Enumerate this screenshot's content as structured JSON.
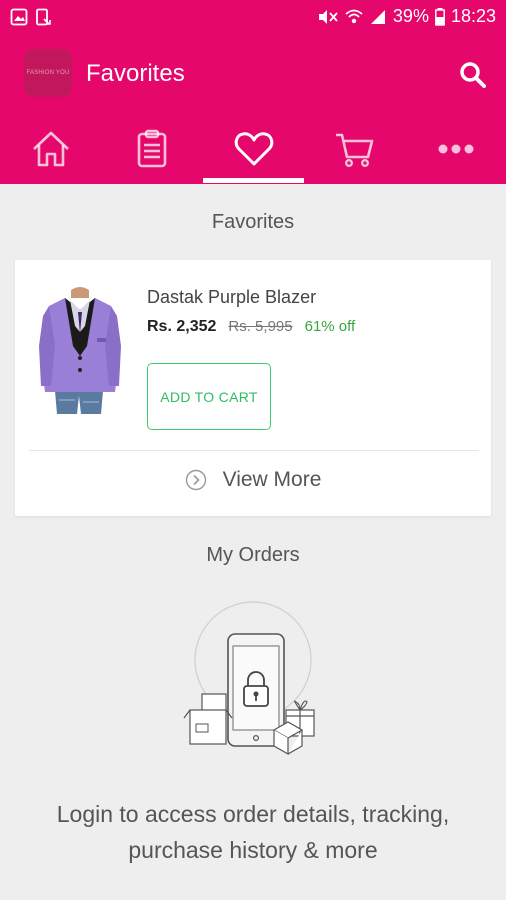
{
  "status_bar": {
    "battery": "39%",
    "time": "18:23"
  },
  "app_bar": {
    "logo_text": "FASHION YOU",
    "title": "Favorites"
  },
  "tabs": [
    {
      "name": "home",
      "icon": "home-icon"
    },
    {
      "name": "orders",
      "icon": "clipboard-icon"
    },
    {
      "name": "favorites",
      "icon": "heart-icon",
      "selected": true
    },
    {
      "name": "cart",
      "icon": "cart-icon"
    },
    {
      "name": "more",
      "icon": "more-icon"
    }
  ],
  "favorites": {
    "heading": "Favorites",
    "item": {
      "name": "Dastak Purple Blazer",
      "price": "Rs. 2,352",
      "mrp": "Rs. 5,995",
      "discount": "61% off",
      "add_to_cart_label": "ADD TO CART"
    },
    "view_more_label": "View More"
  },
  "orders": {
    "heading": "My Orders",
    "login_message": "Login to access order details, tracking, purchase history & more"
  },
  "colors": {
    "brand": "#e5076b",
    "accent_green": "#2ebd63",
    "background": "#eeeeee"
  }
}
